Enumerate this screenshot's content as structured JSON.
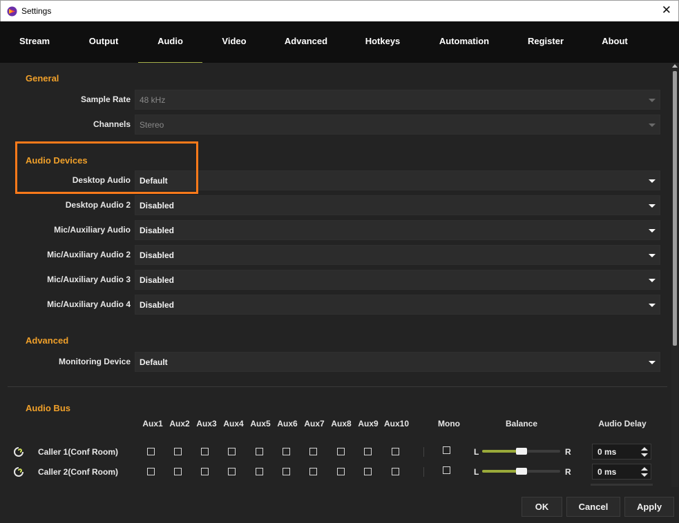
{
  "window": {
    "title": "Settings",
    "close_glyph": "✕"
  },
  "tabs": [
    {
      "label": "Stream"
    },
    {
      "label": "Output"
    },
    {
      "label": "Audio",
      "active": true
    },
    {
      "label": "Video"
    },
    {
      "label": "Advanced"
    },
    {
      "label": "Hotkeys"
    },
    {
      "label": "Automation"
    },
    {
      "label": "Register"
    },
    {
      "label": "About"
    }
  ],
  "general": {
    "title": "General",
    "sample_rate": {
      "label": "Sample Rate",
      "value": "48 kHz"
    },
    "channels": {
      "label": "Channels",
      "value": "Stereo"
    }
  },
  "audio_devices": {
    "title": "Audio Devices",
    "desktop_audio": {
      "label": "Desktop Audio",
      "value": "Default"
    },
    "desktop_audio_2": {
      "label": "Desktop Audio 2",
      "value": "Disabled"
    },
    "mic_aux": {
      "label": "Mic/Auxiliary Audio",
      "value": "Disabled"
    },
    "mic_aux_2": {
      "label": "Mic/Auxiliary Audio 2",
      "value": "Disabled"
    },
    "mic_aux_3": {
      "label": "Mic/Auxiliary Audio 3",
      "value": "Disabled"
    },
    "mic_aux_4": {
      "label": "Mic/Auxiliary Audio 4",
      "value": "Disabled"
    }
  },
  "advanced": {
    "title": "Advanced",
    "monitoring_device": {
      "label": "Monitoring Device",
      "value": "Default"
    }
  },
  "audio_bus": {
    "title": "Audio Bus",
    "headers": {
      "aux1": "Aux1",
      "aux2": "Aux2",
      "aux3": "Aux3",
      "aux4": "Aux4",
      "aux5": "Aux5",
      "aux6": "Aux6",
      "aux7": "Aux7",
      "aux8": "Aux8",
      "aux9": "Aux9",
      "aux10": "Aux10",
      "mono": "Mono",
      "balance": "Balance",
      "delay": "Audio Delay"
    },
    "callers": [
      {
        "name": "Caller 1(Conf Room)",
        "left": "L",
        "right": "R",
        "balance": 0.5,
        "delay": "0 ms"
      },
      {
        "name": "Caller 2(Conf Room)",
        "left": "L",
        "right": "R",
        "balance": 0.5,
        "delay": "0 ms"
      }
    ]
  },
  "buttons": {
    "ok": "OK",
    "cancel": "Cancel",
    "apply": "Apply"
  },
  "colors": {
    "accent": "#f0a02a",
    "highlight": "#ff7a1a",
    "slider": "#9aaa3a"
  }
}
